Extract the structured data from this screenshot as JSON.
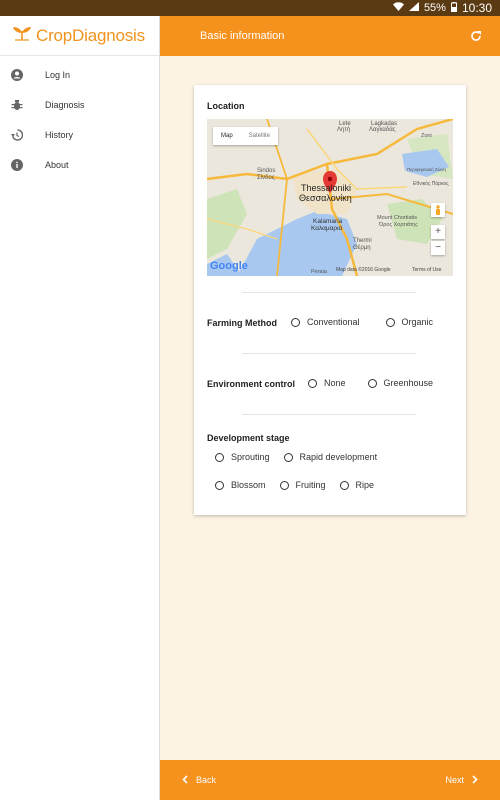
{
  "status_bar": {
    "battery": "55%",
    "time": "10:30"
  },
  "app": {
    "name": "CropDiagnosis"
  },
  "sidebar": {
    "items": [
      {
        "label": "Log In",
        "icon": "account-circle-icon"
      },
      {
        "label": "Diagnosis",
        "icon": "bug-icon"
      },
      {
        "label": "History",
        "icon": "history-icon"
      },
      {
        "label": "About",
        "icon": "info-icon"
      }
    ]
  },
  "appbar": {
    "title": "Basic information"
  },
  "form": {
    "location_label": "Location",
    "map": {
      "tab_map": "Map",
      "tab_satellite": "Satellite",
      "city_en": "Thessaloniki",
      "city_gr": "Θεσσαλονίκη",
      "places": [
        "Lete",
        "Λητή",
        "Lagkadas",
        "Λαγκαδάς",
        "Sindos",
        "Σίνδος",
        "Kalamaria",
        "Καλαμαριά",
        "Thermi",
        "Θέρμη",
        "Mount Chortiatis",
        "Όρος Χορτιάτης",
        "Zoni",
        "Περιφερειακή Ζώνη",
        "Εθνικός Πάρκος",
        "Peraia"
      ],
      "attribution": "Map data ©2016 Google",
      "terms": "Terms of Use",
      "google": "Google",
      "zoom_in": "+",
      "zoom_out": "−"
    },
    "farming_method": {
      "label": "Farming Method",
      "options": [
        "Conventional",
        "Organic"
      ]
    },
    "environment_control": {
      "label": "Environment control",
      "options": [
        "None",
        "Greenhouse"
      ]
    },
    "development_stage": {
      "label": "Development stage",
      "options": [
        "Sprouting",
        "Rapid development",
        "Blossom",
        "Fruiting",
        "Ripe"
      ]
    }
  },
  "bottom": {
    "back": "Back",
    "next": "Next"
  },
  "colors": {
    "accent": "#f5921e",
    "background": "#fdf3e4"
  }
}
